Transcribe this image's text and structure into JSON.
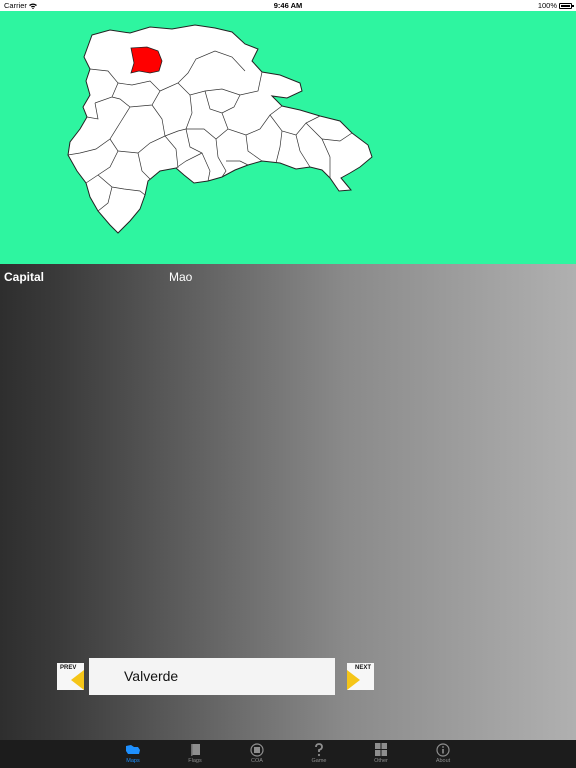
{
  "status": {
    "carrier": "Carrier",
    "time": "9:46 AM",
    "battery": "100%"
  },
  "map": {
    "background": "#2ef5a0",
    "highlight_color": "#ff0000",
    "land_color": "#ffffff"
  },
  "info": {
    "capital_label": "Capital",
    "capital_value": "Mao"
  },
  "navigator": {
    "prev_label": "PREV",
    "next_label": "NEXT",
    "province_name": "Valverde",
    "arrow_color": "#f5c518"
  },
  "tabs": [
    {
      "label": "Maps",
      "icon": "map-icon",
      "active": true
    },
    {
      "label": "Flags",
      "icon": "flag-icon",
      "active": false
    },
    {
      "label": "COA",
      "icon": "coat-of-arms-icon",
      "active": false
    },
    {
      "label": "Game",
      "icon": "question-icon",
      "active": false
    },
    {
      "label": "Other",
      "icon": "grid-icon",
      "active": false
    },
    {
      "label": "About",
      "icon": "info-icon",
      "active": false
    }
  ]
}
